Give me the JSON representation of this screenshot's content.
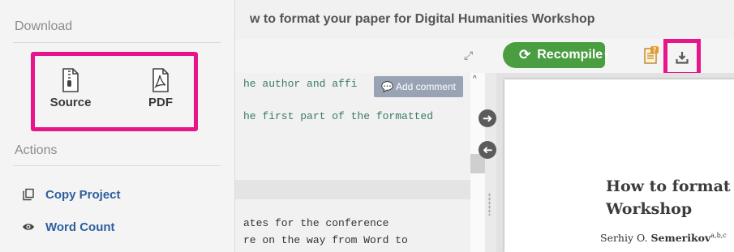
{
  "menu": {
    "download_heading": "Download",
    "download_items": [
      {
        "label": "Source",
        "icon": "zip-file-icon"
      },
      {
        "label": "PDF",
        "icon": "pdf-file-icon"
      }
    ],
    "actions_heading": "Actions",
    "actions": [
      {
        "label": "Copy Project",
        "icon": "copy-icon"
      },
      {
        "label": "Word Count",
        "icon": "eye-icon"
      }
    ]
  },
  "header": {
    "title": "w to format your paper for Digital Humanities Workshop"
  },
  "toolbar": {
    "recompile_label": "Recompile",
    "logs_badge": "7"
  },
  "editor": {
    "lines": [
      "he author and affi",
      "he first part of the formatted",
      "ates for the conference",
      "re on the way from Word to"
    ],
    "add_comment_label": "Add comment"
  },
  "pdf": {
    "title_line1": "How to format",
    "title_line2": "Workshop",
    "author_prefix": "Serhiy O. ",
    "author_name": "Semerikov",
    "author_sup": "a,b,c"
  },
  "colors": {
    "highlight": "#e8148a",
    "recompile_green": "#4a9e41",
    "link_blue": "#2f5f9e"
  }
}
